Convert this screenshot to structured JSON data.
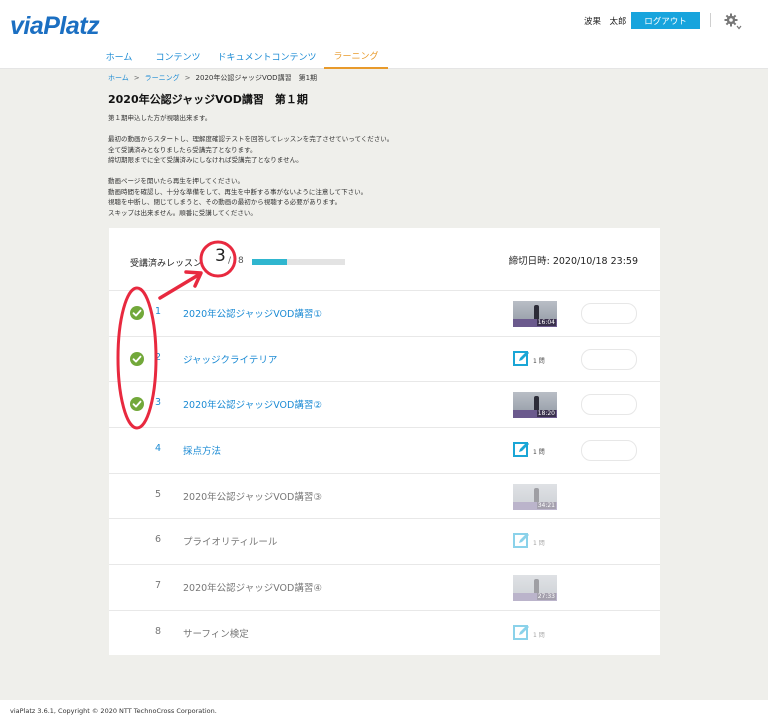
{
  "header": {
    "logo": "viaPlatz",
    "user_name": "波果　太郎",
    "logout_label": "ログアウト",
    "settings_icon": "gear-icon"
  },
  "nav": {
    "items": [
      {
        "label": "ホーム",
        "active": false
      },
      {
        "label": "コンテンツ",
        "active": false
      },
      {
        "label": "ドキュメントコンテンツ",
        "active": false
      },
      {
        "label": "ラーニング",
        "active": true
      }
    ]
  },
  "breadcrumb": {
    "items": [
      "ホーム",
      "ラーニング",
      "2020年公認ジャッジVOD講習　第1期"
    ],
    "separator": ">"
  },
  "page_title": "2020年公認ジャッジVOD講習　第１期",
  "description": {
    "line1": "第１期申込した方が視聴出来ます。",
    "line2": "最初の動画からスタートし、理解度確認テストを回答してレッスンを完了させていってください。",
    "line3": "全て受講済みとなりましたら受講完了となります。",
    "line4": "締切期限までに全て受講済みにしなければ受講完了となりません。",
    "line5": "動画ページを開いたら再生を押してください。",
    "line6": "動画時間を確認し、十分な準備をして、再生を中断する事がないように注意して下さい。",
    "line7": "視聴を中断し、閉じてしまうと、その動画の最初から視聴する必要があります。",
    "line8": "スキップは出来ません。順番に受講してください。"
  },
  "progress": {
    "label": "受講済みレッスン",
    "completed": "3",
    "slash": "/",
    "total": "8",
    "fraction": 0.375,
    "deadline": "締切日時: 2020/10/18 23:59"
  },
  "lessons": [
    {
      "num": "1",
      "title": "2020年公認ジャッジVOD講習①",
      "type": "video",
      "duration": "16:04",
      "done": true,
      "locked": false
    },
    {
      "num": "2",
      "title": "ジャッジクライテリア",
      "type": "test",
      "questions": "1 問",
      "done": true,
      "locked": false
    },
    {
      "num": "3",
      "title": "2020年公認ジャッジVOD講習②",
      "type": "video",
      "duration": "18:20",
      "done": true,
      "locked": false
    },
    {
      "num": "4",
      "title": "採点方法",
      "type": "test",
      "questions": "1 問",
      "done": false,
      "locked": false
    },
    {
      "num": "5",
      "title": "2020年公認ジャッジVOD講習③",
      "type": "video",
      "duration": "34:21",
      "done": false,
      "locked": true
    },
    {
      "num": "6",
      "title": "プライオリティルール",
      "type": "test",
      "questions": "1 問",
      "done": false,
      "locked": true
    },
    {
      "num": "7",
      "title": "2020年公認ジャッジVOD講習④",
      "type": "video",
      "duration": "27:33",
      "done": false,
      "locked": true
    },
    {
      "num": "8",
      "title": "サーフィン検定",
      "type": "test",
      "questions": "1 問",
      "done": false,
      "locked": true
    }
  ],
  "footer": {
    "copyright": "viaPlatz 3.6.1, Copyright © 2020 NTT TechnoCross Corporation."
  },
  "colors": {
    "accent": "#17a4dd",
    "link": "#1c8bd4",
    "active_tab": "#e89a2b",
    "progress_fill": "#2fb6cf",
    "check": "#72a83a",
    "annotation": "#e8293f"
  }
}
